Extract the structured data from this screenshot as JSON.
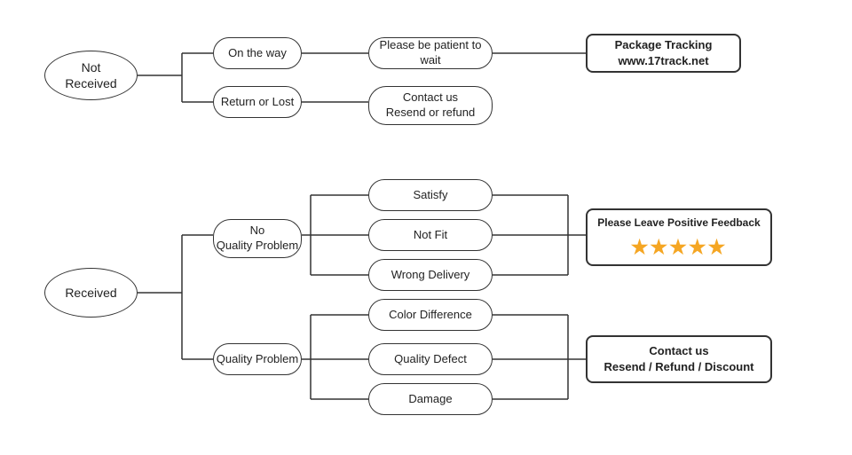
{
  "nodes": {
    "not_received": {
      "label": "Not\nReceived"
    },
    "on_the_way": {
      "label": "On the way"
    },
    "return_or_lost": {
      "label": "Return or Lost"
    },
    "patient": {
      "label": "Please be patient to wait"
    },
    "contact_resend": {
      "label": "Contact us\nResend or refund"
    },
    "package_tracking": {
      "label": "Package Tracking\nwww.17track.net"
    },
    "received": {
      "label": "Received"
    },
    "no_quality_problem": {
      "label": "No\nQuality Problem"
    },
    "quality_problem": {
      "label": "Quality Problem"
    },
    "satisfy": {
      "label": "Satisfy"
    },
    "not_fit": {
      "label": "Not Fit"
    },
    "wrong_delivery": {
      "label": "Wrong Delivery"
    },
    "color_difference": {
      "label": "Color Difference"
    },
    "quality_defect": {
      "label": "Quality Defect"
    },
    "damage": {
      "label": "Damage"
    },
    "positive_feedback": {
      "label": "Please Leave Positive Feedback"
    },
    "stars": {
      "label": "★★★★★"
    },
    "contact_us_2": {
      "label": "Contact us\nResend / Refund / Discount"
    }
  }
}
